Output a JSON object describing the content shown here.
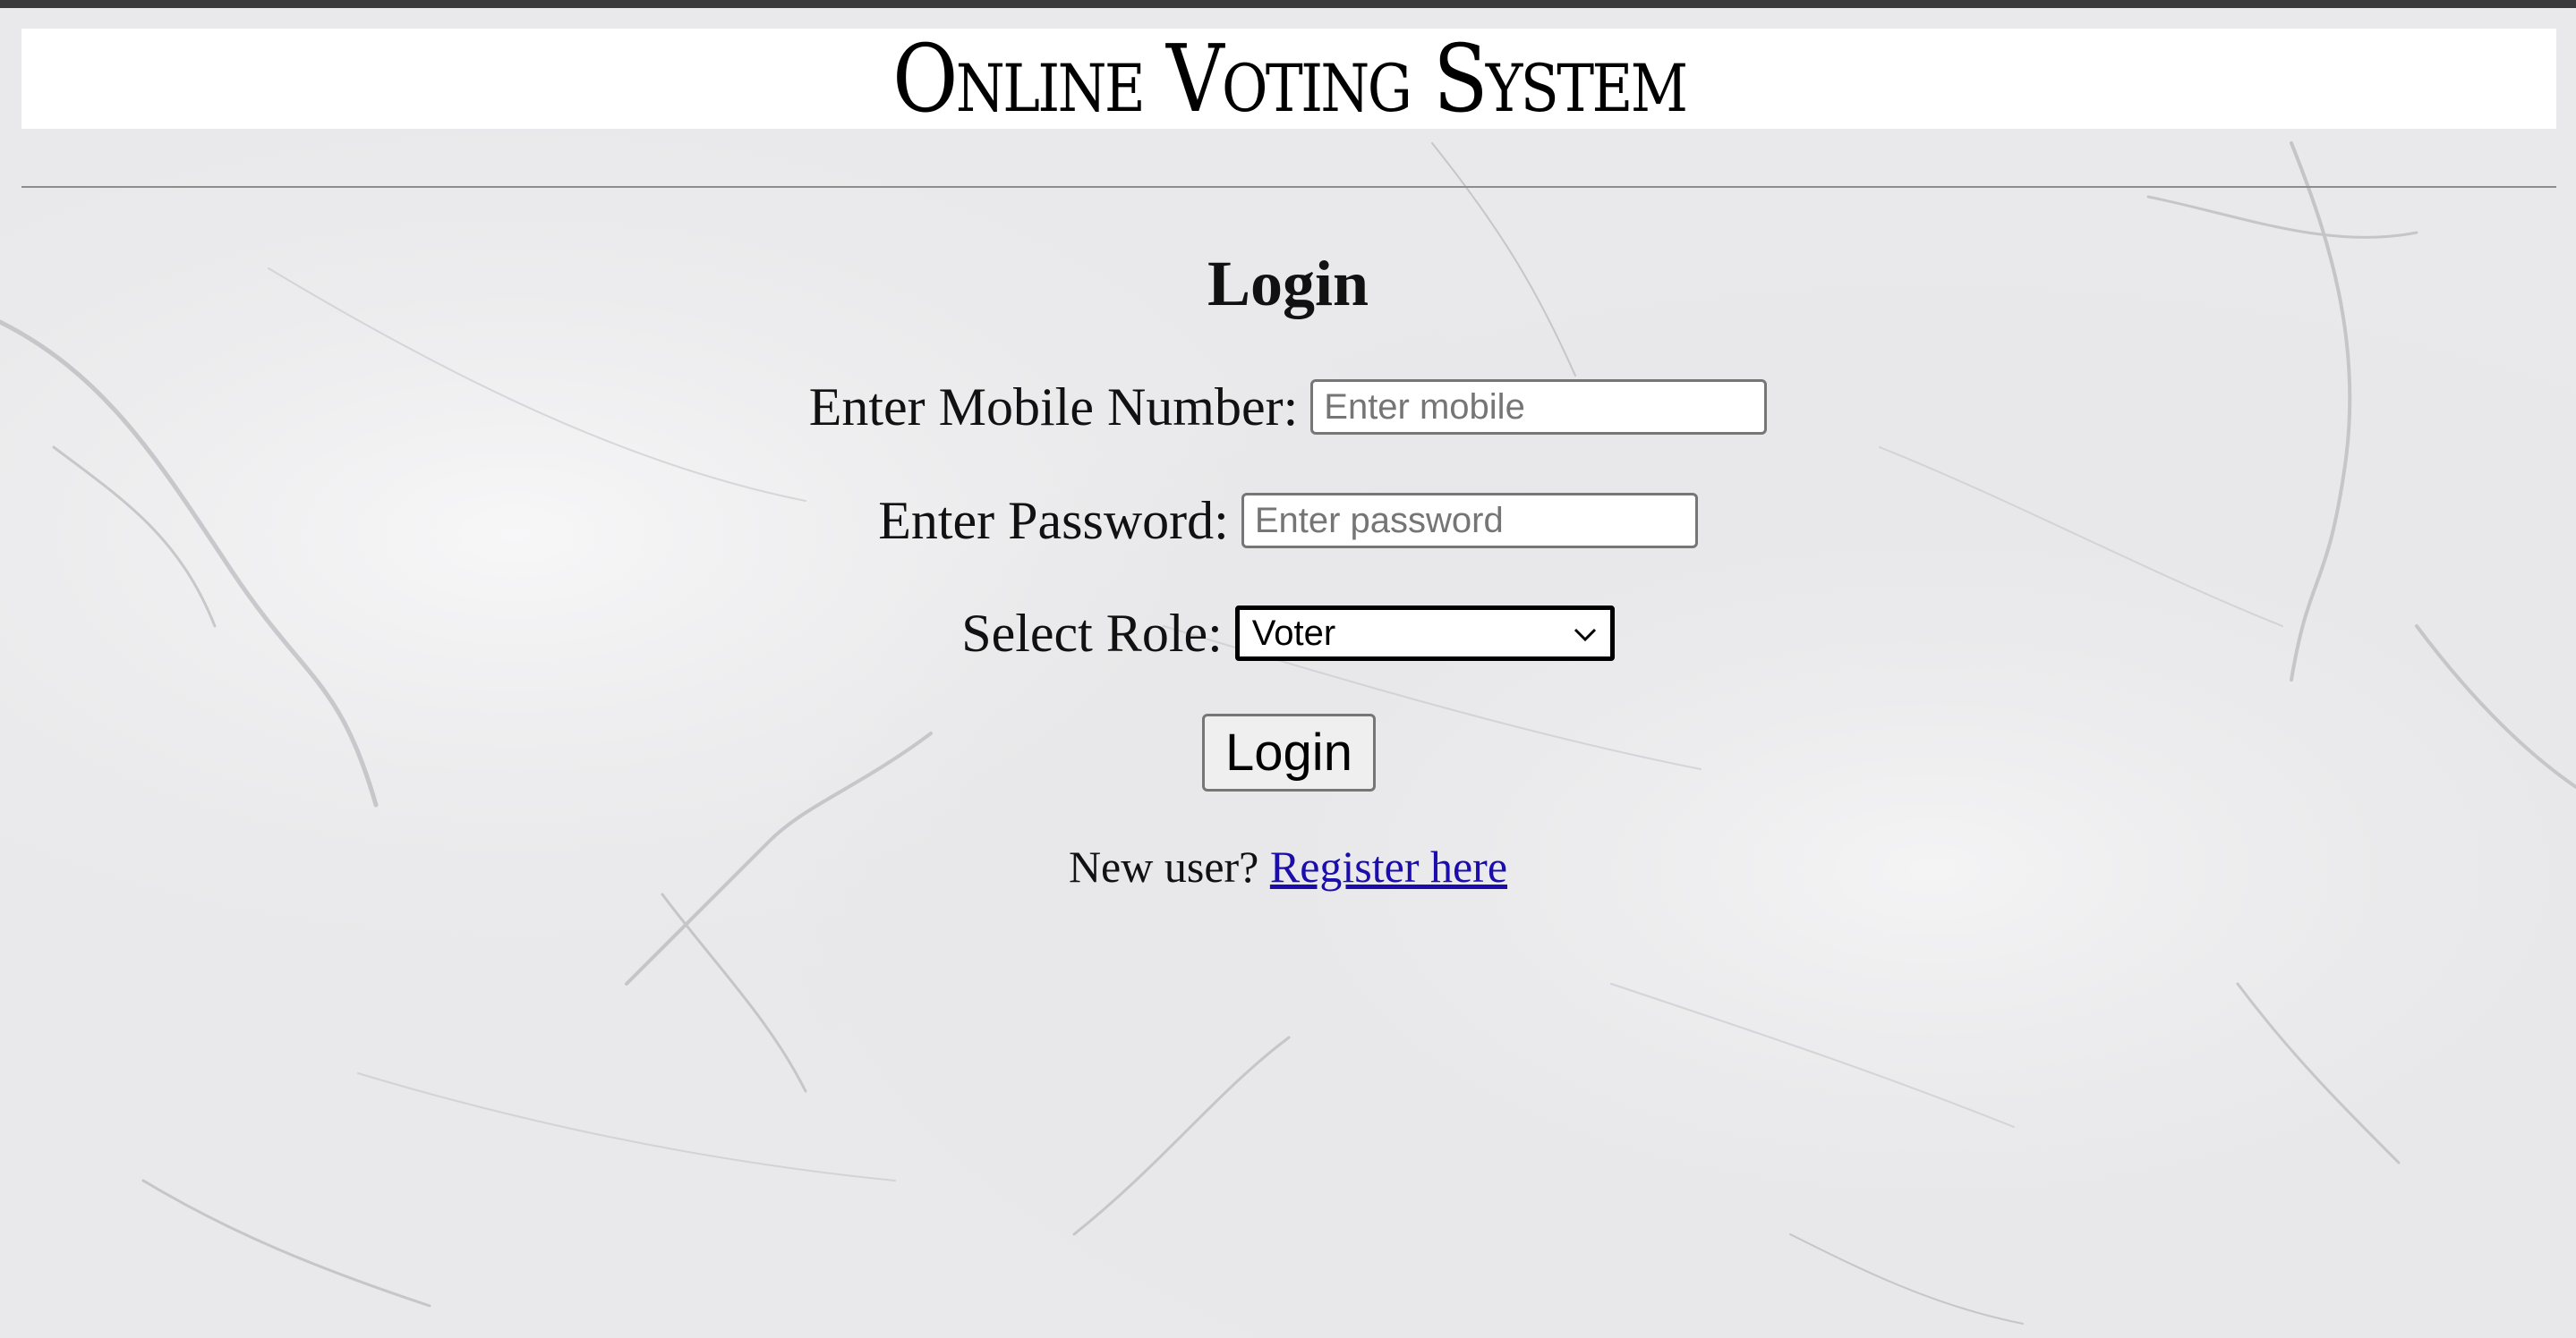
{
  "header": {
    "title": "Online Voting System"
  },
  "login_form": {
    "heading": "Login",
    "mobile": {
      "label": "Enter Mobile Number:",
      "placeholder": "Enter mobile",
      "value": ""
    },
    "password": {
      "label": "Enter Password:",
      "placeholder": "Enter password",
      "value": ""
    },
    "role": {
      "label": "Select Role:",
      "selected": "Voter",
      "icon": "chevron-down-icon"
    },
    "submit_label": "Login",
    "register_prompt": "New user?",
    "register_link": "Register here"
  },
  "colors": {
    "background": "#ececee",
    "header_background": "#ffffff",
    "link": "#1a0dab",
    "text": "#111111"
  }
}
